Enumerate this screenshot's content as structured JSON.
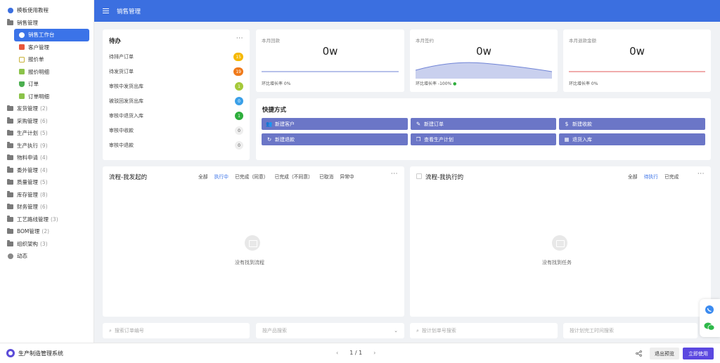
{
  "sidebar": {
    "items": [
      {
        "label": "模板使用教程",
        "icon": "guide-icon",
        "level": 0
      },
      {
        "label": "销售管理",
        "icon": "folder-icon",
        "level": 0
      },
      {
        "label": "销售工作台",
        "icon": "dashboard-icon",
        "level": 1,
        "active": true
      },
      {
        "label": "客户管理",
        "icon": "customer-icon",
        "level": 1
      },
      {
        "label": "报价单",
        "icon": "quote-icon",
        "level": 1
      },
      {
        "label": "报价明细",
        "icon": "quote-detail-icon",
        "level": 1
      },
      {
        "label": "订单",
        "icon": "order-icon",
        "level": 1
      },
      {
        "label": "订单明细",
        "icon": "order-detail-icon",
        "level": 1
      },
      {
        "label": "发货管理",
        "count": "(2)",
        "icon": "folder-icon",
        "level": 0
      },
      {
        "label": "采购管理",
        "count": "(6)",
        "icon": "folder-icon",
        "level": 0
      },
      {
        "label": "生产计划",
        "count": "(5)",
        "icon": "folder-icon",
        "level": 0
      },
      {
        "label": "生产执行",
        "count": "(9)",
        "icon": "folder-icon",
        "level": 0
      },
      {
        "label": "物料申请",
        "count": "(4)",
        "icon": "folder-icon",
        "level": 0
      },
      {
        "label": "委外管理",
        "count": "(4)",
        "icon": "folder-icon",
        "level": 0
      },
      {
        "label": "质量管理",
        "count": "(5)",
        "icon": "folder-icon",
        "level": 0
      },
      {
        "label": "库存管理",
        "count": "(8)",
        "icon": "folder-icon",
        "level": 0
      },
      {
        "label": "财务管理",
        "count": "(6)",
        "icon": "folder-icon",
        "level": 0
      },
      {
        "label": "工艺路线管理",
        "count": "(3)",
        "icon": "folder-icon",
        "level": 0
      },
      {
        "label": "BOM管理",
        "count": "(2)",
        "icon": "folder-icon",
        "level": 0
      },
      {
        "label": "组织架构",
        "count": "(3)",
        "icon": "folder-icon",
        "level": 0
      },
      {
        "label": "动态",
        "icon": "activity-icon",
        "level": 0
      }
    ]
  },
  "header": {
    "title": "销售管理"
  },
  "todo": {
    "title": "待办",
    "more": "···",
    "rows": [
      {
        "label": "待排产订单",
        "count": "15",
        "color": "#f5b800"
      },
      {
        "label": "待发货订单",
        "count": "19",
        "color": "#f07a1a"
      },
      {
        "label": "审核中发货出库",
        "count": "1",
        "color": "#a5c93a"
      },
      {
        "label": "被驳回发货出库",
        "count": "0",
        "color": "#3aa0e8"
      },
      {
        "label": "审核中退货入库",
        "count": "1",
        "color": "#2eae3c"
      },
      {
        "label": "审核中收款",
        "count": "0",
        "color": "#eeeeee"
      },
      {
        "label": "审核中退款",
        "count": "0",
        "color": "#eeeeee"
      }
    ]
  },
  "stats": [
    {
      "label": "本月回款",
      "value": "0w",
      "foot": "环比增长率 0%",
      "line_color": "#6f83d6"
    },
    {
      "label": "本月签约",
      "value": "0w",
      "foot": "环比增长率 -100%",
      "line_color": "#6f83d6"
    },
    {
      "label": "本月退款金额",
      "value": "0w",
      "foot": "环比增长率 0%",
      "line_color": "#e05a5a"
    }
  ],
  "quick": {
    "title": "快捷方式",
    "buttons": [
      {
        "label": "新建客户",
        "icon": "add-user-icon"
      },
      {
        "label": "新建订单",
        "icon": "edit-icon"
      },
      {
        "label": "新建收款",
        "icon": "dollar-icon"
      },
      {
        "label": "新建退款",
        "icon": "refund-icon"
      },
      {
        "label": "查看生产计划",
        "icon": "copy-icon"
      },
      {
        "label": "退货入库",
        "icon": "warehouse-icon"
      }
    ]
  },
  "process_mine": {
    "title": "流程-我发起的",
    "tabs": [
      "全部",
      "执行中",
      "已完成（同意）",
      "已完成（不同意）",
      "已取消",
      "异常中"
    ],
    "active_tab": 1,
    "more": "···",
    "empty": "没有找到流程"
  },
  "process_exec": {
    "title": "流程-我执行的",
    "tabs": [
      "全部",
      "待执行",
      "已完成"
    ],
    "active_tab": 1,
    "more": "···",
    "empty": "没有找到任务"
  },
  "filters": [
    {
      "placeholder": "搜索订单编号"
    },
    {
      "placeholder": "按产品搜索"
    },
    {
      "placeholder": "按计划单号搜索"
    },
    {
      "placeholder": "按计划完工时间搜索"
    }
  ],
  "footer": {
    "brand": "生产制造管理系统",
    "page": "1 / 1",
    "prev": "‹",
    "next": "›",
    "exit_label": "退出预览",
    "use_label": "立即使用"
  },
  "colors": {
    "primary": "#3b6fe0",
    "quick_button": "#6b76c7",
    "use_button": "#5b48e0"
  }
}
